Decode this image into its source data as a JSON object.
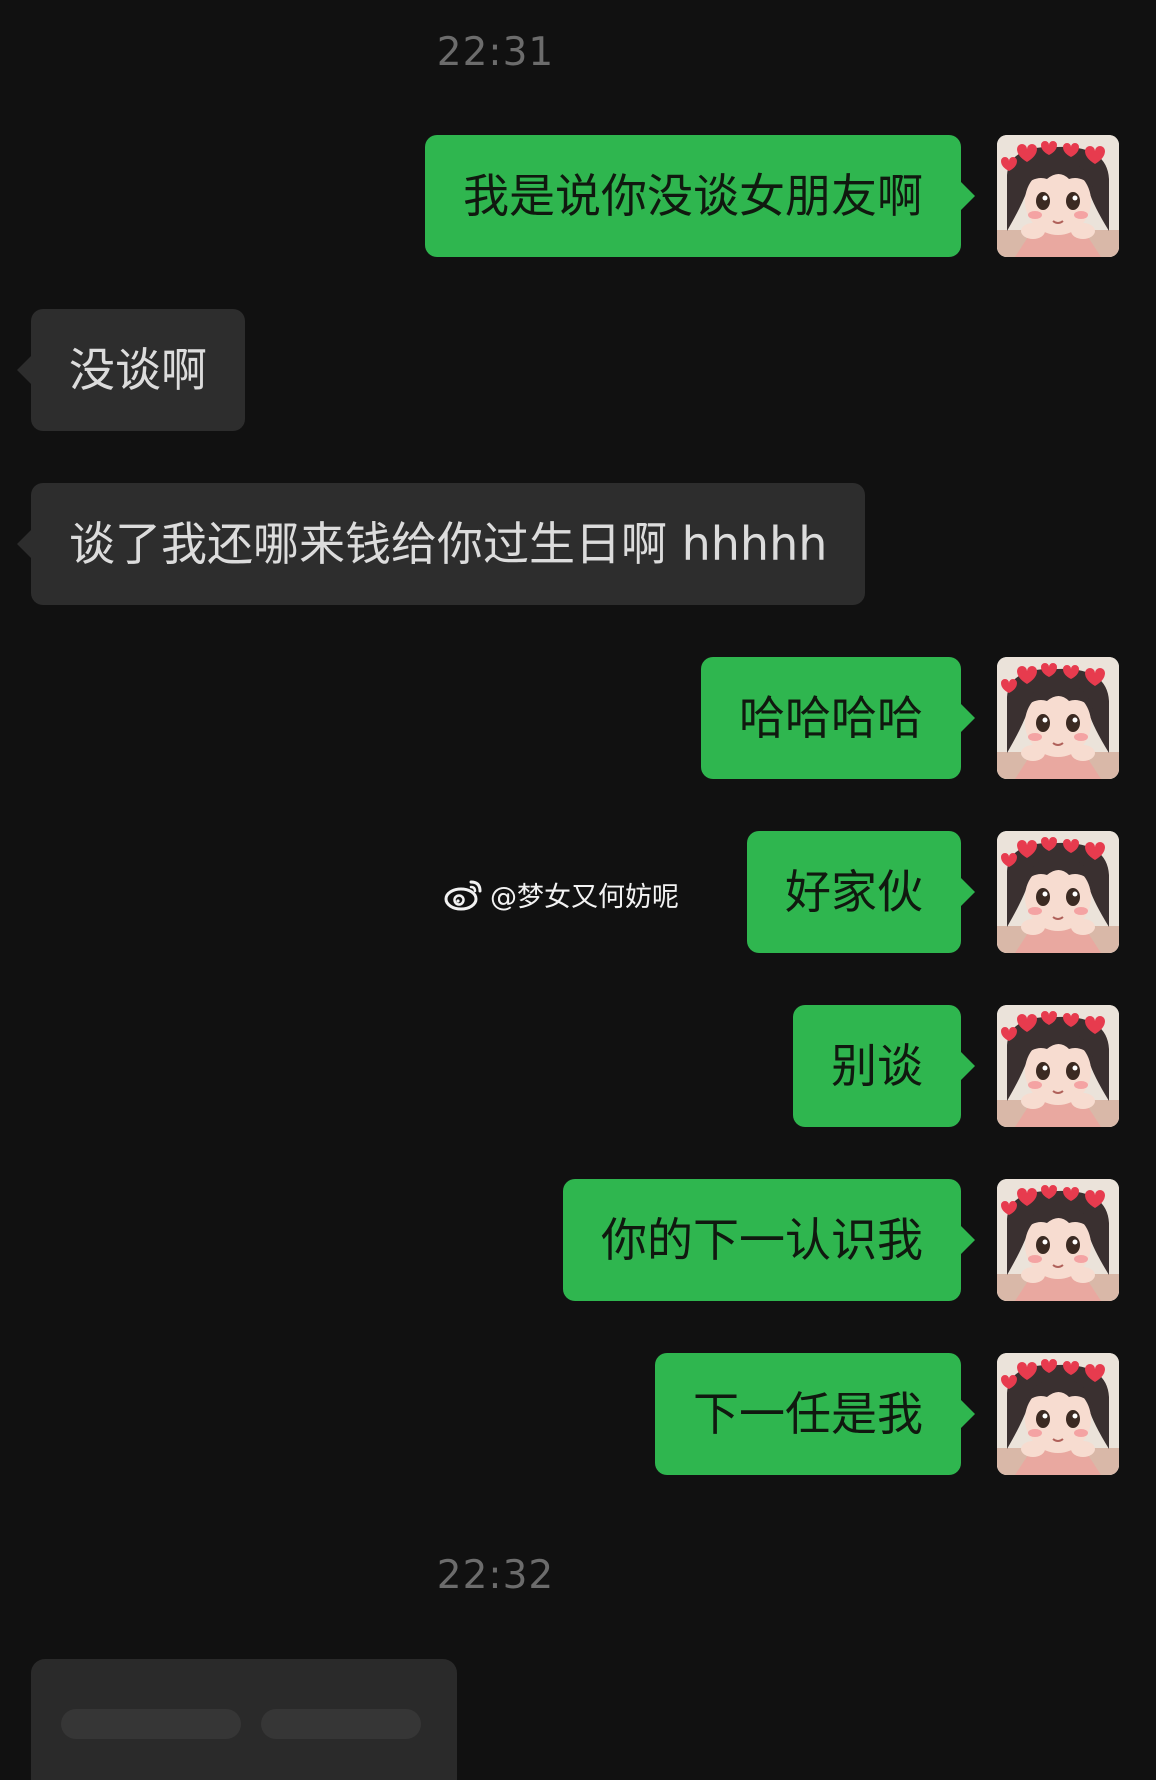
{
  "timestamps": [
    "22:31",
    "22:32"
  ],
  "messages": [
    {
      "side": "out",
      "text": "我是说你没谈女朋友啊"
    },
    {
      "side": "in",
      "text": "没谈啊"
    },
    {
      "side": "in",
      "text": "谈了我还哪来钱给你过生日啊 hhhhh"
    },
    {
      "side": "out",
      "text": "哈哈哈哈"
    },
    {
      "side": "out",
      "text": "好家伙"
    },
    {
      "side": "out",
      "text": "别谈"
    },
    {
      "side": "out",
      "text": "你的下一认识我"
    },
    {
      "side": "out",
      "text": "下一任是我"
    }
  ],
  "watermark": {
    "text": "@梦女又何妨呢",
    "icon": "weibo-icon"
  },
  "colors": {
    "background": "#111111",
    "outgoing": "#2fb64f",
    "incoming": "#2d2d2d",
    "timestamp": "#6c6c6c"
  },
  "avatar": {
    "icon": "anime-girl-avatar"
  }
}
